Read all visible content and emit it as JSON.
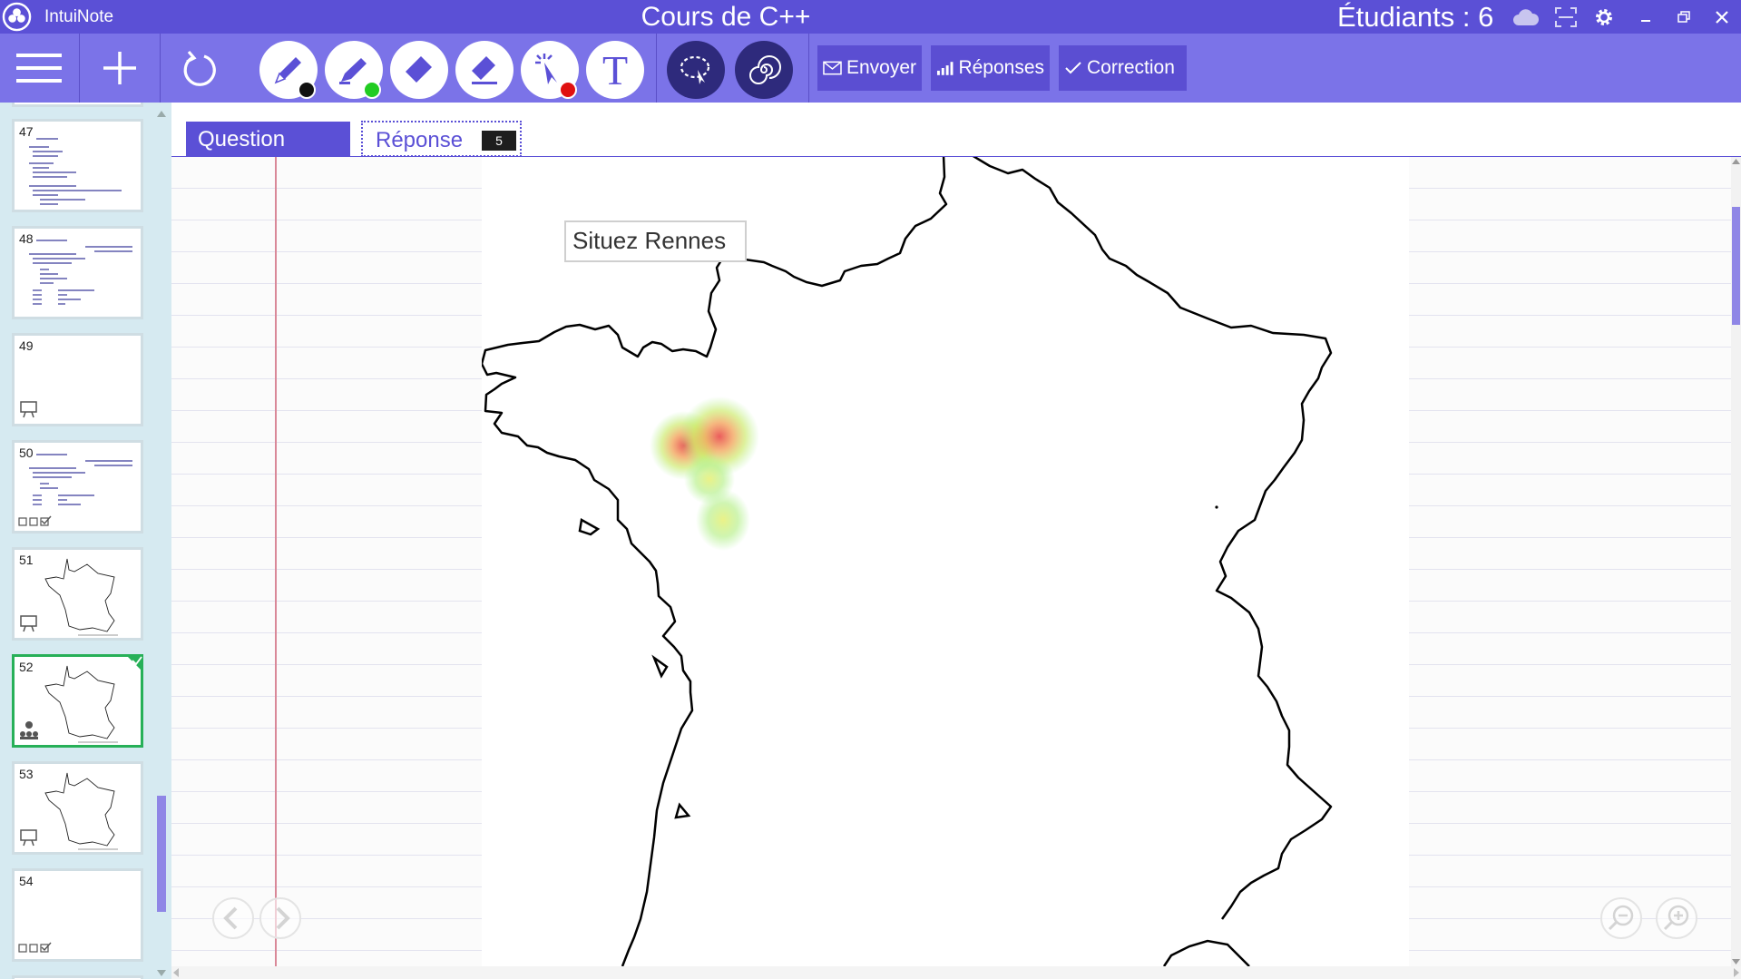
{
  "app": {
    "name": "IntuiNote",
    "document_title": "Cours de C++",
    "students_label": "Étudiants : 6"
  },
  "window_controls": {
    "icons": [
      "cloud-icon",
      "fullscreen-icon",
      "gear-icon",
      "minimize-icon",
      "restore-icon",
      "close-icon"
    ]
  },
  "toolbar": {
    "envoyer_label": "Envoyer",
    "reponses_label": "Réponses",
    "correction_label": "Correction",
    "text_tool_label": "T",
    "pen_colors": {
      "black": "#111111",
      "green": "#22cc22",
      "red": "#e01010"
    }
  },
  "sidebar": {
    "slides": [
      {
        "number": "47"
      },
      {
        "number": "48"
      },
      {
        "number": "49"
      },
      {
        "number": "50"
      },
      {
        "number": "51"
      },
      {
        "number": "52"
      },
      {
        "number": "53"
      },
      {
        "number": "54"
      }
    ],
    "active_slide": "52"
  },
  "tabs": {
    "question_label": "Question",
    "reponse_label": "Réponse",
    "response_count": "5"
  },
  "canvas": {
    "question_text": "Situez Rennes"
  },
  "colors": {
    "accent": "#5b50d6",
    "toolbar": "#7b73e8",
    "sidebar": "#d6eaf1",
    "active_slide_border": "#27b058"
  }
}
